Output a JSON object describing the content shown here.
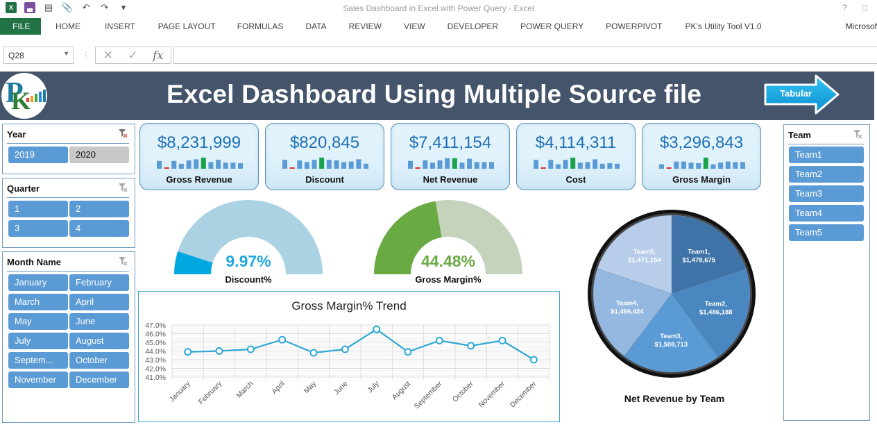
{
  "window": {
    "title": "Sales Dashboard in Excel with Power Query - Excel",
    "help": "?",
    "account": "Microsof"
  },
  "ribbon": {
    "tabs": [
      "FILE",
      "HOME",
      "INSERT",
      "PAGE LAYOUT",
      "FORMULAS",
      "DATA",
      "REVIEW",
      "VIEW",
      "DEVELOPER",
      "POWER QUERY",
      "POWERPIVOT",
      "PK's Utility Tool V1.0"
    ]
  },
  "formula_bar": {
    "name_box": "Q28",
    "formula": "",
    "fx_label": "fx"
  },
  "banner": {
    "title": "Excel Dashboard Using Multiple Source file",
    "tabular_button": "Tabular"
  },
  "slicers": {
    "year": {
      "title": "Year",
      "items": [
        {
          "label": "2019",
          "selected": true
        },
        {
          "label": "2020",
          "selected": false
        }
      ]
    },
    "quarter": {
      "title": "Quarter",
      "items": [
        {
          "label": "1"
        },
        {
          "label": "2"
        },
        {
          "label": "3"
        },
        {
          "label": "4"
        }
      ]
    },
    "month": {
      "title": "Month Name",
      "items": [
        {
          "label": "January"
        },
        {
          "label": "February"
        },
        {
          "label": "March"
        },
        {
          "label": "April"
        },
        {
          "label": "May"
        },
        {
          "label": "June"
        },
        {
          "label": "July"
        },
        {
          "label": "August"
        },
        {
          "label": "Septem..."
        },
        {
          "label": "October"
        },
        {
          "label": "November"
        },
        {
          "label": "December"
        }
      ]
    },
    "team": {
      "title": "Team",
      "items": [
        {
          "label": "Team1"
        },
        {
          "label": "Team2"
        },
        {
          "label": "Team3"
        },
        {
          "label": "Team4"
        },
        {
          "label": "Team5"
        }
      ]
    }
  },
  "kpis": [
    {
      "label": "Gross Revenue",
      "value": "$8,231,999",
      "spark": [
        0.7,
        0.08,
        0.7,
        0.45,
        0.75,
        0.85,
        1.0,
        0.6,
        0.8,
        0.55,
        0.55,
        0.5
      ],
      "max_index": 6,
      "min_index": 1
    },
    {
      "label": "Discount",
      "value": "$820,845",
      "spark": [
        0.8,
        0.08,
        0.75,
        0.6,
        0.8,
        1.0,
        0.8,
        0.75,
        0.6,
        0.65,
        0.85,
        0.45
      ],
      "max_index": 5,
      "min_index": 1
    },
    {
      "label": "Net Revenue",
      "value": "$7,411,154",
      "spark": [
        0.7,
        0.08,
        0.75,
        0.55,
        0.75,
        0.95,
        0.95,
        0.55,
        0.9,
        0.6,
        0.6,
        0.6
      ],
      "max_index": 6,
      "min_index": 1
    },
    {
      "label": "Cost",
      "value": "$4,114,311",
      "spark": [
        0.8,
        0.08,
        0.8,
        0.4,
        0.8,
        1.0,
        0.55,
        0.6,
        0.85,
        0.45,
        0.5,
        0.45
      ],
      "max_index": 5,
      "min_index": 1
    },
    {
      "label": "Gross Margin",
      "value": "$3,296,843",
      "spark": [
        0.4,
        0.08,
        0.65,
        0.65,
        0.55,
        0.5,
        1.0,
        0.4,
        0.55,
        0.65,
        0.6,
        0.6
      ],
      "max_index": 6,
      "min_index": 1
    }
  ],
  "gauges": [
    {
      "name": "discount",
      "label": "Discount%",
      "value_text": "9.97%",
      "value": 0.0997,
      "fill": "#00a8e0",
      "track": "#aad2e2",
      "text_color": "#1fa7df"
    },
    {
      "name": "gross-margin",
      "label": "Gross Margin%",
      "value_text": "44.48%",
      "value": 0.4448,
      "fill": "#6aaa43",
      "track": "#c5d3bd",
      "text_color": "#6aaa43"
    }
  ],
  "chart_data": [
    {
      "type": "line",
      "title": "Gross Margin% Trend",
      "categories": [
        "January",
        "February",
        "March",
        "April",
        "May",
        "June",
        "July",
        "August",
        "September",
        "October",
        "November",
        "December"
      ],
      "series": [
        {
          "name": "Gross Margin%",
          "values": [
            43.9,
            44.0,
            44.2,
            45.3,
            43.8,
            44.2,
            46.5,
            43.9,
            45.2,
            44.6,
            45.2,
            43.0
          ],
          "color": "#2ea8d5"
        }
      ],
      "yticks": [
        "47.0%",
        "46.0%",
        "45.0%",
        "44.0%",
        "43.0%",
        "42.0%",
        "41.0%"
      ],
      "ylim": [
        41.0,
        47.0
      ],
      "xlabel": "",
      "ylabel": "",
      "grid": true
    },
    {
      "type": "pie",
      "title": "Net Revenue by Team",
      "categories": [
        "Team1",
        "Team2",
        "Team3",
        "Team4",
        "Team5"
      ],
      "values": [
        1478675,
        1486188,
        1508713,
        1466424,
        1471154
      ],
      "labels": [
        "$1,478,675",
        "$1,486,188",
        "$1,508,713",
        "$1,466,424",
        "$1,471,154"
      ],
      "colors": [
        "#3f72a6",
        "#4a87c0",
        "#5b9bd5",
        "#94b8df",
        "#b7cde9"
      ]
    }
  ]
}
